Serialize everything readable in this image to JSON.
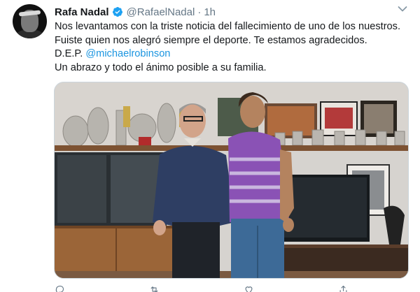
{
  "tweet": {
    "author_name": "Rafa Nadal",
    "handle": "@RafaelNadal",
    "separator": "·",
    "time": "1h",
    "text_lines": [
      "Nos levantamos con la triste noticia del fallecimiento de uno de los nuestros.",
      "Fuiste quien nos alegró siempre el deporte. Te estamos agradecidos.",
      "D.E.P. ",
      "Un abrazo y todo el ánimo posible a su familia."
    ],
    "mention": "@michaelrobinson"
  },
  "icons": {
    "verified": "verified-badge-icon",
    "caret": "chevron-down-icon",
    "reply": "reply-icon",
    "retweet": "retweet-icon",
    "like": "like-icon",
    "share": "share-icon"
  },
  "colors": {
    "accent": "#1da1f2",
    "mention": "#1b95e0",
    "muted": "#657786",
    "text": "#14171a"
  }
}
